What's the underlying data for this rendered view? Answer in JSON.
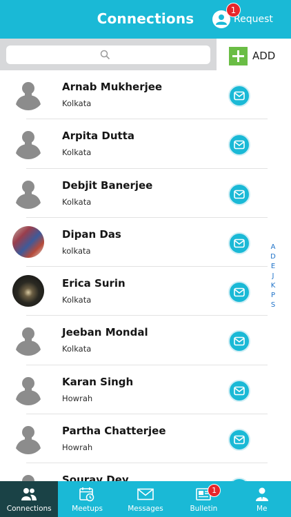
{
  "header": {
    "title": "Connections",
    "request_label": "Request",
    "request_badge": "1"
  },
  "search": {
    "placeholder": ""
  },
  "add_button": {
    "label": "ADD"
  },
  "contacts": [
    {
      "name": "Arnab Mukherjee",
      "city": "Kolkata",
      "avatar": "generic"
    },
    {
      "name": "Arpita Dutta",
      "city": "Kolkata",
      "avatar": "generic"
    },
    {
      "name": "Debjit Banerjee",
      "city": "Kolkata",
      "avatar": "generic"
    },
    {
      "name": "Dipan Das",
      "city": "kolkata",
      "avatar": "photo1"
    },
    {
      "name": "Erica Surin",
      "city": "Kolkata",
      "avatar": "photo2"
    },
    {
      "name": "Jeeban Mondal",
      "city": "Kolkata",
      "avatar": "generic"
    },
    {
      "name": "Karan Singh",
      "city": "Howrah",
      "avatar": "generic"
    },
    {
      "name": "Partha Chatterjee",
      "city": "Howrah",
      "avatar": "generic"
    },
    {
      "name": "Sourav Dey",
      "city": "",
      "avatar": "generic"
    }
  ],
  "alphabet_index": [
    "A",
    "D",
    "E",
    "J",
    "K",
    "P",
    "S"
  ],
  "tabs": [
    {
      "label": "Connections",
      "icon": "people-icon",
      "active": true,
      "badge": ""
    },
    {
      "label": "Meetups",
      "icon": "calendar-clock-icon",
      "active": false,
      "badge": ""
    },
    {
      "label": "Messages",
      "icon": "envelope-icon",
      "active": false,
      "badge": ""
    },
    {
      "label": "Bulletin",
      "icon": "newspaper-icon",
      "active": false,
      "badge": "1"
    },
    {
      "label": "Me",
      "icon": "profile-icon",
      "active": false,
      "badge": ""
    }
  ],
  "colors": {
    "primary": "#1ab9d6",
    "active_tab": "#1a4246",
    "badge": "#e8262b",
    "add_green": "#6abd45",
    "index_blue": "#1e72c8"
  }
}
